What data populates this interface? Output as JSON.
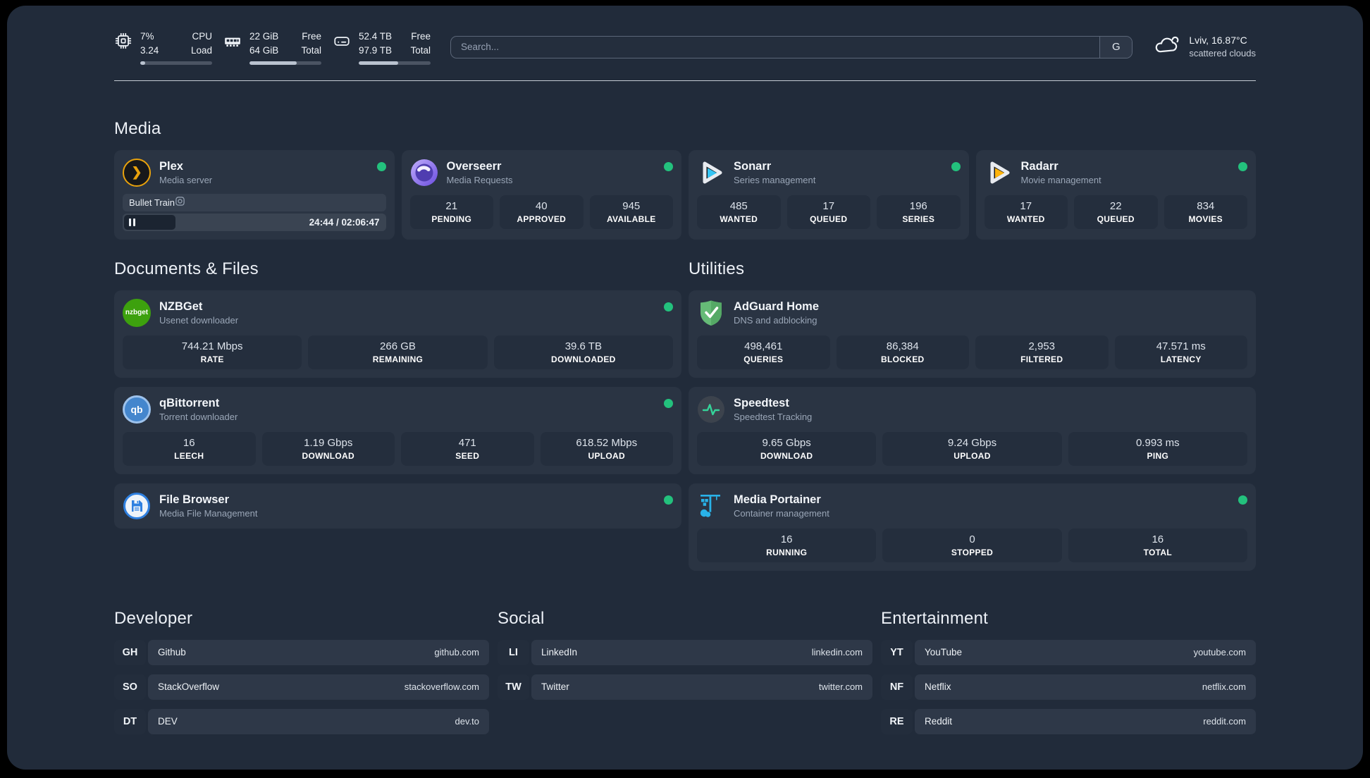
{
  "header": {
    "cpu": {
      "value_top": "7%",
      "value_bottom": "3.24",
      "label_top": "CPU",
      "label_bottom": "Load",
      "bar_percent": 7
    },
    "ram": {
      "value_top": "22 GiB",
      "value_bottom": "64 GiB",
      "label_top": "Free",
      "label_bottom": "Total",
      "bar_percent": 66
    },
    "disk": {
      "value_top": "52.4 TB",
      "value_bottom": "97.9 TB",
      "label_top": "Free",
      "label_bottom": "Total",
      "bar_percent": 55
    },
    "search": {
      "placeholder": "Search...",
      "engine_label": "G"
    },
    "weather": {
      "location_temp": "Lviv, 16.87°C",
      "condition": "scattered clouds"
    }
  },
  "media": {
    "title": "Media",
    "plex": {
      "title": "Plex",
      "subtitle": "Media server",
      "icon_glyph": "❯",
      "now_playing": "Bullet Train",
      "time": "24:44 / 02:06:47",
      "progress_percent": 19.5
    },
    "overseerr": {
      "title": "Overseerr",
      "subtitle": "Media Requests",
      "stats": [
        {
          "value": "21",
          "label": "PENDING"
        },
        {
          "value": "40",
          "label": "APPROVED"
        },
        {
          "value": "945",
          "label": "AVAILABLE"
        }
      ]
    },
    "sonarr": {
      "title": "Sonarr",
      "subtitle": "Series management",
      "stats": [
        {
          "value": "485",
          "label": "WANTED"
        },
        {
          "value": "17",
          "label": "QUEUED"
        },
        {
          "value": "196",
          "label": "SERIES"
        }
      ]
    },
    "radarr": {
      "title": "Radarr",
      "subtitle": "Movie management",
      "stats": [
        {
          "value": "17",
          "label": "WANTED"
        },
        {
          "value": "22",
          "label": "QUEUED"
        },
        {
          "value": "834",
          "label": "MOVIES"
        }
      ]
    }
  },
  "documents": {
    "title": "Documents & Files",
    "nzbget": {
      "title": "NZBGet",
      "subtitle": "Usenet downloader",
      "icon_text": "nzbget",
      "stats": [
        {
          "value": "744.21 Mbps",
          "label": "RATE"
        },
        {
          "value": "266 GB",
          "label": "REMAINING"
        },
        {
          "value": "39.6 TB",
          "label": "DOWNLOADED"
        }
      ]
    },
    "qbittorrent": {
      "title": "qBittorrent",
      "subtitle": "Torrent downloader",
      "icon_text": "qb",
      "stats": [
        {
          "value": "16",
          "label": "LEECH"
        },
        {
          "value": "1.19 Gbps",
          "label": "DOWNLOAD"
        },
        {
          "value": "471",
          "label": "SEED"
        },
        {
          "value": "618.52 Mbps",
          "label": "UPLOAD"
        }
      ]
    },
    "filebrowser": {
      "title": "File Browser",
      "subtitle": "Media File Management"
    }
  },
  "utilities": {
    "title": "Utilities",
    "adguard": {
      "title": "AdGuard Home",
      "subtitle": "DNS and adblocking",
      "stats": [
        {
          "value": "498,461",
          "label": "QUERIES"
        },
        {
          "value": "86,384",
          "label": "BLOCKED"
        },
        {
          "value": "2,953",
          "label": "FILTERED"
        },
        {
          "value": "47.571 ms",
          "label": "LATENCY"
        }
      ]
    },
    "speedtest": {
      "title": "Speedtest",
      "subtitle": "Speedtest Tracking",
      "stats": [
        {
          "value": "9.65 Gbps",
          "label": "DOWNLOAD"
        },
        {
          "value": "9.24 Gbps",
          "label": "UPLOAD"
        },
        {
          "value": "0.993 ms",
          "label": "PING"
        }
      ]
    },
    "portainer": {
      "title": "Media Portainer",
      "subtitle": "Container management",
      "stats": [
        {
          "value": "16",
          "label": "RUNNING"
        },
        {
          "value": "0",
          "label": "STOPPED"
        },
        {
          "value": "16",
          "label": "TOTAL"
        }
      ]
    }
  },
  "links": {
    "developer": {
      "title": "Developer",
      "items": [
        {
          "abbr": "GH",
          "name": "Github",
          "url": "github.com"
        },
        {
          "abbr": "SO",
          "name": "StackOverflow",
          "url": "stackoverflow.com"
        },
        {
          "abbr": "DT",
          "name": "DEV",
          "url": "dev.to"
        }
      ]
    },
    "social": {
      "title": "Social",
      "items": [
        {
          "abbr": "LI",
          "name": "LinkedIn",
          "url": "linkedin.com"
        },
        {
          "abbr": "TW",
          "name": "Twitter",
          "url": "twitter.com"
        }
      ]
    },
    "entertainment": {
      "title": "Entertainment",
      "items": [
        {
          "abbr": "YT",
          "name": "YouTube",
          "url": "youtube.com"
        },
        {
          "abbr": "NF",
          "name": "Netflix",
          "url": "netflix.com"
        },
        {
          "abbr": "RE",
          "name": "Reddit",
          "url": "reddit.com"
        }
      ]
    }
  },
  "colors": {
    "background": "#212b3a",
    "card": "#2a3443",
    "tile": "#242e3d",
    "status_online": "#23c17d",
    "plex_orange": "#e9a20c",
    "sonarr_blue": "#35c5f4",
    "radarr_yellow": "#ffb40c",
    "adguard_green": "#5fb770",
    "portainer_blue": "#29b2e8",
    "nzbget_green": "#3da10e",
    "qbittorrent_blue": "#4486cd",
    "speedtest_green": "#35d399"
  }
}
